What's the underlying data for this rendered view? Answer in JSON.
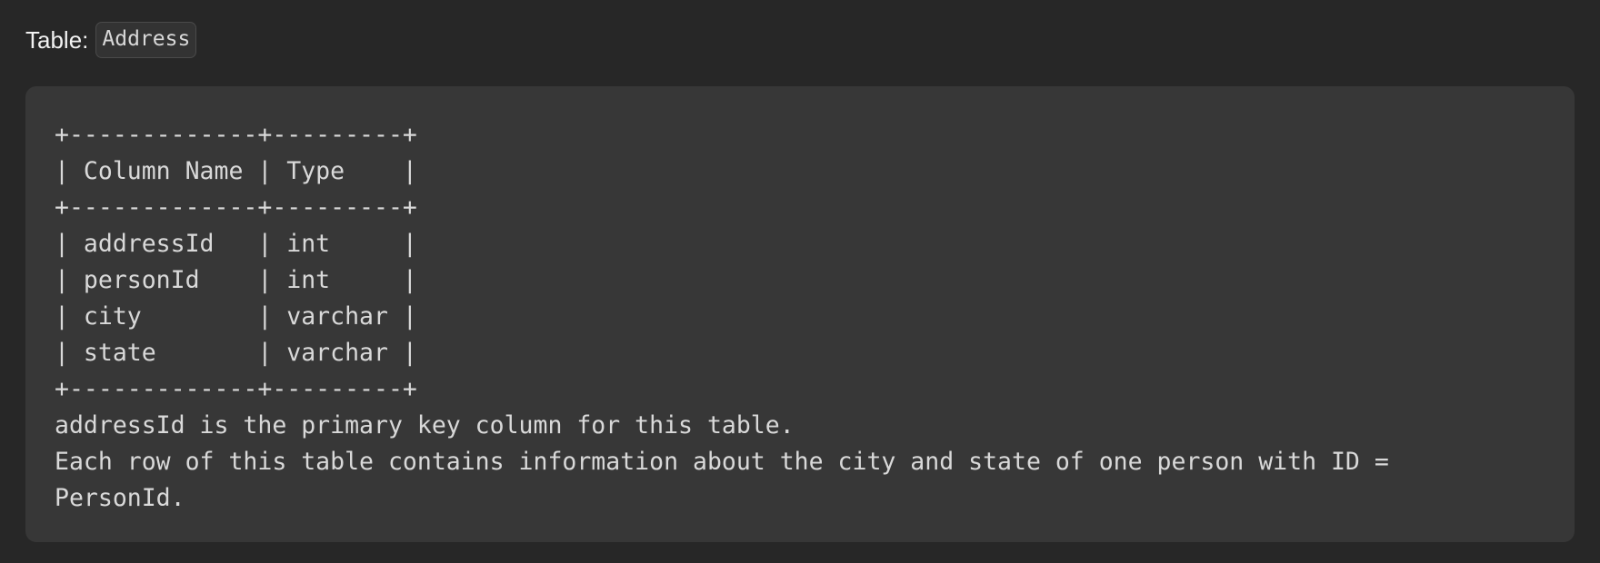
{
  "heading": {
    "label": "Table:",
    "table_name": "Address"
  },
  "code": {
    "lines": [
      "+-------------+---------+",
      "| Column Name | Type    |",
      "+-------------+---------+",
      "| addressId   | int     |",
      "| personId    | int     |",
      "| city        | varchar |",
      "| state       | varchar |",
      "+-------------+---------+",
      "addressId is the primary key column for this table.",
      "Each row of this table contains information about the city and state of one person with ID =",
      "PersonId."
    ]
  }
}
